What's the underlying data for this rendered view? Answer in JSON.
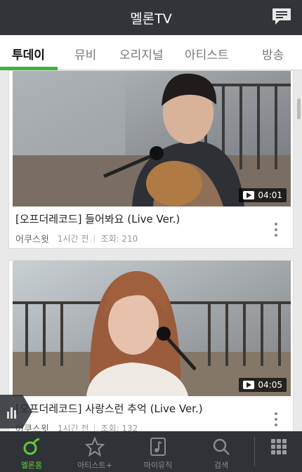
{
  "header": {
    "title": "멜론TV",
    "chat_icon": "chat-icon"
  },
  "tabs": [
    {
      "label": "투데이",
      "active": true
    },
    {
      "label": "뮤비"
    },
    {
      "label": "오리지널"
    },
    {
      "label": "아티스트"
    },
    {
      "label": "방송"
    }
  ],
  "videos": [
    {
      "title": "[오프더레코드] 들어봐요 (Live Ver.)",
      "artist": "어쿠스윗",
      "time": "1시간 전",
      "views": "조회: 210",
      "duration": "04:01"
    },
    {
      "title": "[오프더레코드] 사랑스런 추억 (Live Ver.)",
      "artist": "어쿠스윗",
      "time": "1시간 전",
      "views": "조회: 132",
      "duration": "04:05"
    }
  ],
  "bottom_nav": [
    {
      "label": "멜론홈",
      "icon": "melon-home-icon",
      "active": true
    },
    {
      "label": "아티스트+",
      "icon": "star-icon"
    },
    {
      "label": "마이뮤직",
      "icon": "my-music-icon"
    },
    {
      "label": "검색",
      "icon": "search-icon"
    },
    {
      "label": "",
      "icon": "grid-menu-icon"
    }
  ],
  "colors": {
    "accent": "#3cb53c",
    "header_bg": "#313438",
    "bottom_bg": "#2f3236"
  }
}
